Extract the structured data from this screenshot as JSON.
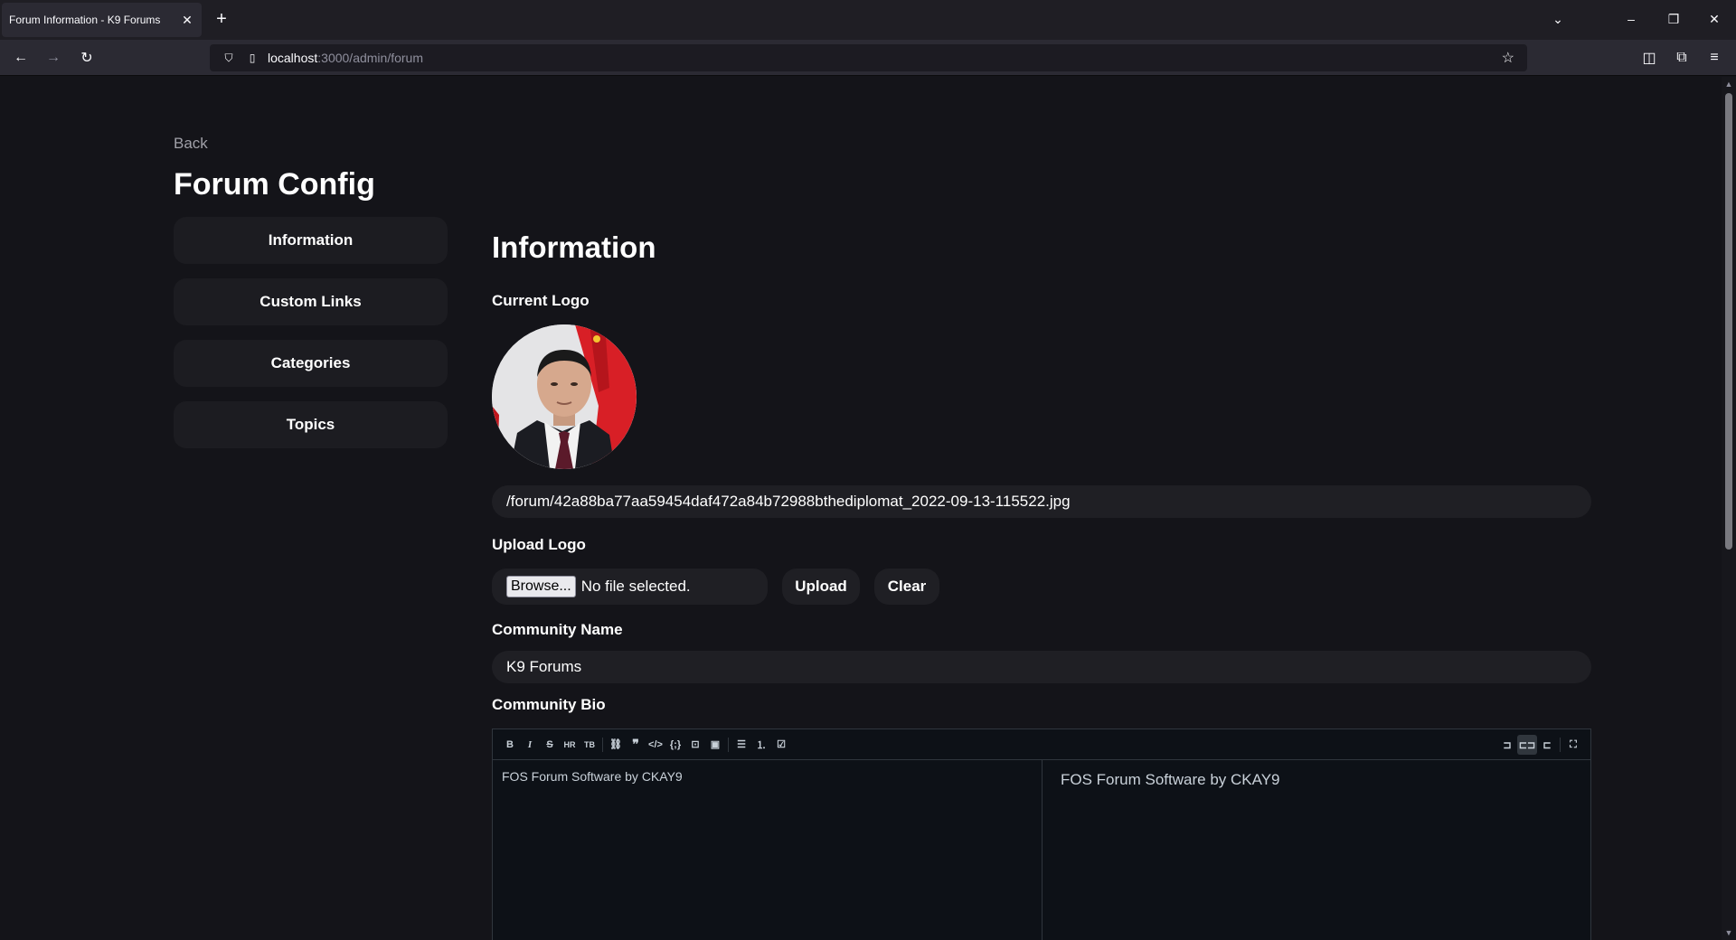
{
  "browser": {
    "tab_title": "Forum Information - K9 Forums",
    "url_host": "localhost",
    "url_path": ":3000/admin/forum"
  },
  "page": {
    "back_label": "Back",
    "title": "Forum Config",
    "sidebar": {
      "items": [
        {
          "label": "Information"
        },
        {
          "label": "Custom Links"
        },
        {
          "label": "Categories"
        },
        {
          "label": "Topics"
        }
      ]
    },
    "section_title": "Information",
    "current_logo_label": "Current Logo",
    "logo_path": "/forum/42a88ba77aa59454daf472a84b72988bthediplomat_2022-09-13-115522.jpg",
    "upload_logo_label": "Upload Logo",
    "browse_label": "Browse...",
    "file_status": "No file selected.",
    "upload_button": "Upload",
    "clear_button": "Clear",
    "community_name_label": "Community Name",
    "community_name_value": "K9 Forums",
    "community_bio_label": "Community Bio",
    "bio_text": "FOS Forum Software by CKAY9",
    "bio_preview": "FOS Forum Software by CKAY9"
  },
  "icons": {
    "toolbar": [
      "bold-icon",
      "italic-icon",
      "strikethrough-icon",
      "heading-icon",
      "heading-alt-icon",
      "link-icon",
      "quote-icon",
      "code-icon",
      "code-block-icon",
      "comment-icon",
      "image-icon",
      "unordered-list-icon",
      "ordered-list-icon",
      "task-list-icon"
    ],
    "view_modes": [
      "edit-only-icon",
      "split-view-icon",
      "preview-only-icon",
      "fullscreen-icon"
    ]
  }
}
